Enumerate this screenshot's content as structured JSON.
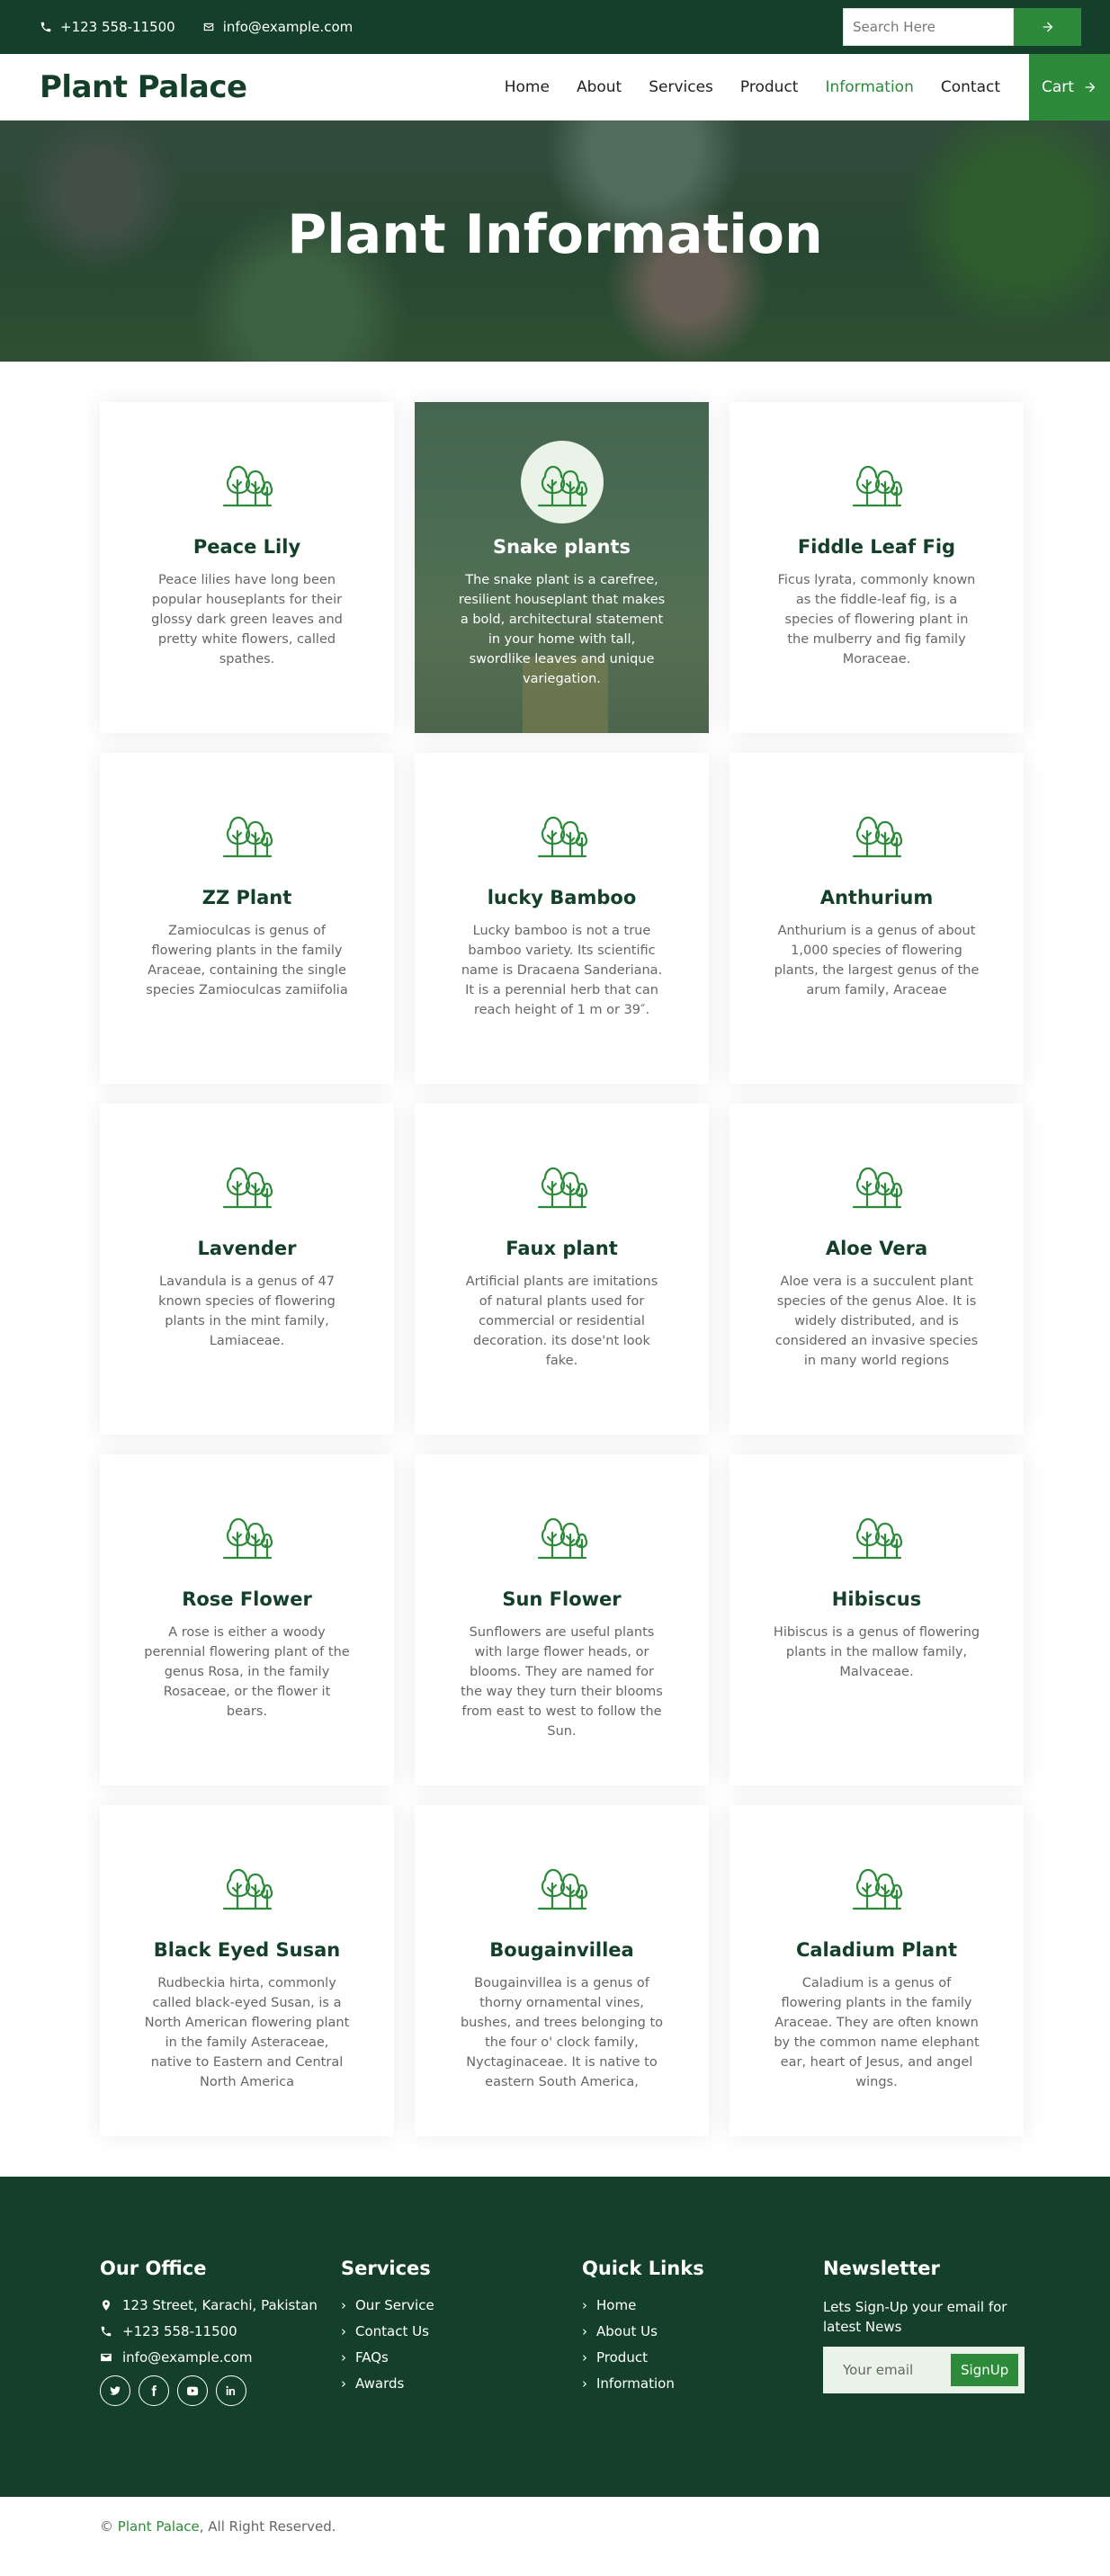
{
  "topbar": {
    "phone": "+123 558-11500",
    "email": "info@example.com",
    "search_placeholder": "Search Here"
  },
  "nav": {
    "brand": "Plant Palace",
    "items": [
      {
        "label": "Home",
        "active": false
      },
      {
        "label": "About",
        "active": false
      },
      {
        "label": "Services",
        "active": false
      },
      {
        "label": "Product",
        "active": false
      },
      {
        "label": "Information",
        "active": true
      },
      {
        "label": "Contact",
        "active": false
      }
    ],
    "cart_label": "Cart"
  },
  "hero": {
    "title": "Plant Information"
  },
  "plants": [
    {
      "name": "Peace Lily",
      "description": "Peace lilies have long been popular houseplants for their glossy dark green leaves and pretty white flowers, called spathes."
    },
    {
      "name": "Snake plants",
      "description": "The snake plant is a carefree, resilient houseplant that makes a bold, architectural statement in your home with tall, swordlike leaves and unique variegation."
    },
    {
      "name": "Fiddle Leaf Fig",
      "description": "Ficus lyrata, commonly known as the fiddle-leaf fig, is a species of flowering plant in the mulberry and fig family Moraceae."
    },
    {
      "name": "ZZ Plant",
      "description": "Zamioculcas is genus of flowering plants in the family Araceae, containing the single species Zamioculcas zamiifolia"
    },
    {
      "name": "lucky Bamboo",
      "description": "Lucky bamboo is not a true bamboo variety. Its scientific name is Dracaena Sanderiana. It is a perennial herb that can reach height of 1 m or 39″."
    },
    {
      "name": "Anthurium",
      "description": "Anthurium is a genus of about 1,000 species of flowering plants, the largest genus of the arum family, Araceae"
    },
    {
      "name": "Lavender",
      "description": "Lavandula is a genus of 47 known species of flowering plants in the mint family, Lamiaceae."
    },
    {
      "name": "Faux plant",
      "description": "Artificial plants are imitations of natural plants used for commercial or residential decoration. its dose'nt look fake."
    },
    {
      "name": "Aloe Vera",
      "description": "Aloe vera is a succulent plant species of the genus Aloe. It is widely distributed, and is considered an invasive species in many world regions"
    },
    {
      "name": "Rose Flower",
      "description": "A rose is either a woody perennial flowering plant of the genus Rosa, in the family Rosaceae, or the flower it bears."
    },
    {
      "name": "Sun Flower",
      "description": "Sunflowers are useful plants with large flower heads, or blooms. They are named for the way they turn their blooms from east to west to follow the Sun."
    },
    {
      "name": "Hibiscus",
      "description": "Hibiscus is a genus of flowering plants in the mallow family, Malvaceae."
    },
    {
      "name": "Black Eyed Susan",
      "description": "Rudbeckia hirta, commonly called black-eyed Susan, is a North American flowering plant in the family Asteraceae, native to Eastern and Central North America"
    },
    {
      "name": "Bougainvillea",
      "description": "Bougainvillea is a genus of thorny ornamental vines, bushes, and trees belonging to the four o' clock family, Nyctaginaceae. It is native to eastern South America,"
    },
    {
      "name": "Caladium Plant",
      "description": "Caladium is a genus of flowering plants in the family Araceae. They are often known by the common name elephant ear, heart of Jesus, and angel wings."
    }
  ],
  "footer": {
    "office": {
      "title": "Our Office",
      "address": "123 Street, Karachi, Pakistan",
      "phone": "+123 558-11500",
      "email": "info@example.com"
    },
    "services": {
      "title": "Services",
      "links": [
        "Our Service",
        "Contact Us",
        "FAQs",
        "Awards"
      ]
    },
    "quick_links": {
      "title": "Quick Links",
      "links": [
        "Home",
        "About Us",
        "Product",
        "Information"
      ]
    },
    "newsletter": {
      "title": "Newsletter",
      "text": "Lets Sign-Up your email for latest News",
      "placeholder": "Your email",
      "button": "SignUp"
    }
  },
  "copyright": {
    "prefix": "©",
    "brand": "Plant Palace",
    "suffix": ", All Right Reserved."
  },
  "colors": {
    "dark_green": "#14402b",
    "accent_green": "#2d8a3a"
  }
}
